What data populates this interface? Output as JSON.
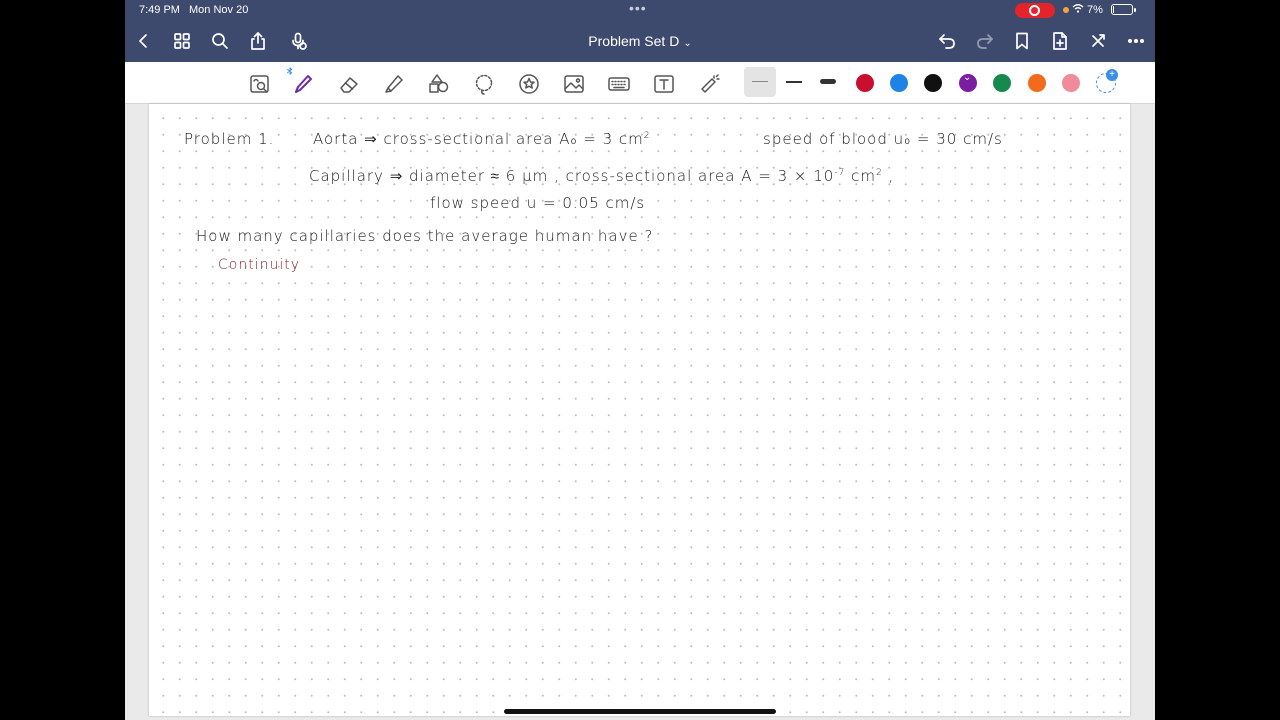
{
  "status_bar": {
    "time": "7:49 PM",
    "date": "Mon Nov 20",
    "dots": "•••",
    "battery_text": "7%",
    "battery_level": 0.07
  },
  "nav": {
    "title": "Problem Set D",
    "title_chevron": "⌄"
  },
  "toolbar": {
    "colors": [
      "#c8102e",
      "#1e82e6",
      "#111111",
      "#7a1fa2",
      "#168a4c",
      "#f26a1b",
      "#f08c9a"
    ],
    "selected_color": "#7a1fa2",
    "add_color_symbol": "+"
  },
  "note": {
    "line1": {
      "problem_label": "Problem 1.",
      "aorta": "Aorta ⇒ cross-sectional area A₀ = 3 cm",
      "aorta_exp": "2",
      "speed": "speed of blood u₀ = 30 cm/s"
    },
    "line2": {
      "capillary": "Capillary ⇒ diameter ≈ 6 μm , cross-sectional area A = 3 × 10",
      "exp1": "-7",
      "cm": " cm",
      "exp2": "2",
      "comma": " ,"
    },
    "line3": "flow speed u = 0.05 cm/s",
    "question": "How many capillaries does the average human have ?",
    "annotation": "Continuity"
  }
}
